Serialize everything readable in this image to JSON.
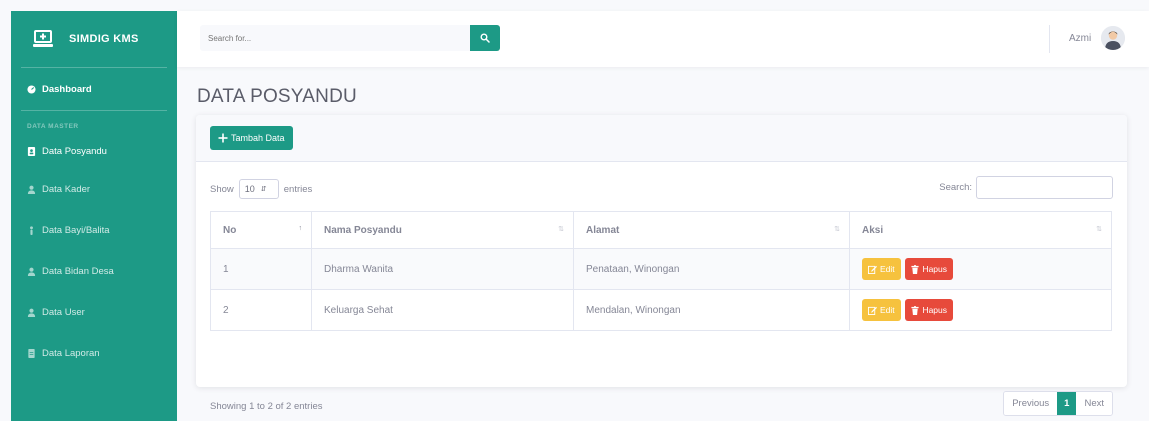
{
  "brand": {
    "name": "SIMDIG KMS"
  },
  "sidebar": {
    "dashboard_label": "Dashboard",
    "heading": "DATA MASTER",
    "items": [
      {
        "label": "Data Posyandu"
      },
      {
        "label": "Data Kader"
      },
      {
        "label": "Data Bayi/Balita"
      },
      {
        "label": "Data Bidan Desa"
      },
      {
        "label": "Data User"
      },
      {
        "label": "Data Laporan"
      }
    ]
  },
  "topbar": {
    "search_placeholder": "Search for...",
    "user_name": "Azmi"
  },
  "page": {
    "title": "DATA POSYANDU"
  },
  "toolbar": {
    "add_label": "Tambah Data"
  },
  "table_controls": {
    "show_label": "Show",
    "entries_value": "10",
    "entries_label": "entries",
    "search_label": "Search:"
  },
  "table": {
    "columns": [
      "No",
      "Nama Posyandu",
      "Alamat",
      "Aksi"
    ],
    "rows": [
      {
        "no": "1",
        "nama": "Dharma Wanita",
        "alamat": "Penataan, Winongan"
      },
      {
        "no": "2",
        "nama": "Keluarga Sehat",
        "alamat": "Mendalan, Winongan"
      }
    ],
    "edit_label": "Edit",
    "delete_label": "Hapus"
  },
  "footer": {
    "info": "Showing 1 to 2 of 2 entries",
    "previous_label": "Previous",
    "current_page": "1",
    "next_label": "Next"
  },
  "colors": {
    "primary": "#1d9a86",
    "warning": "#f6c23e",
    "danger": "#e74a3b"
  }
}
